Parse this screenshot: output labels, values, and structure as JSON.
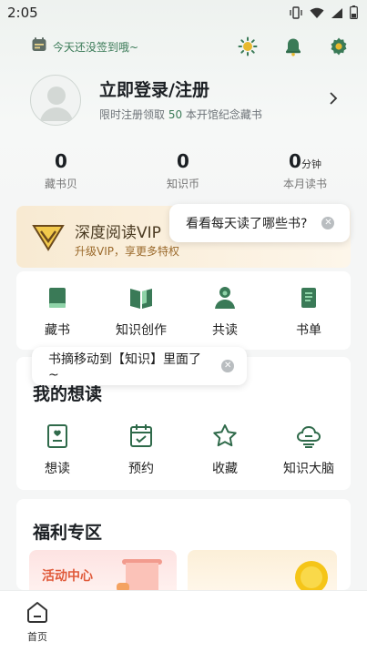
{
  "status_bar": {
    "time": "2:05"
  },
  "header": {
    "checkin_label": "今天还没签到哦~",
    "icons": [
      "sun-icon",
      "bell-icon",
      "settings-icon"
    ]
  },
  "profile": {
    "login_title": "立即登录/注册",
    "sub_prefix": "限时注册领取 ",
    "sub_highlight": "50",
    "sub_suffix": " 本开馆纪念藏书"
  },
  "stats": [
    {
      "value": "0",
      "unit": "",
      "label": "藏书贝"
    },
    {
      "value": "0",
      "unit": "",
      "label": "知识币"
    },
    {
      "value": "0",
      "unit": "分钟",
      "label": "本月读书"
    }
  ],
  "vip": {
    "title": "深度阅读VIP",
    "subtitle": "升级VIP，享更多特权"
  },
  "tooltips": {
    "reading_hint": "看看每天读了哪些书?",
    "excerpt_hint": "书摘移动到【知识】里面了~"
  },
  "quick_grid": [
    {
      "label": "藏书",
      "icon": "book-icon"
    },
    {
      "label": "知识创作",
      "icon": "open-book-icon"
    },
    {
      "label": "共读",
      "icon": "people-icon"
    },
    {
      "label": "书单",
      "icon": "list-icon"
    }
  ],
  "wishlist": {
    "title": "我的想读",
    "items": [
      {
        "label": "想读",
        "icon": "wish-book-icon"
      },
      {
        "label": "预约",
        "icon": "calendar-check-icon"
      },
      {
        "label": "收藏",
        "icon": "star-icon"
      },
      {
        "label": "知识大脑",
        "icon": "brain-cloud-icon"
      }
    ]
  },
  "welfare": {
    "title": "福利专区",
    "left_label": "活动中心"
  },
  "bottom_nav": {
    "home_label": "首页"
  },
  "colors": {
    "accent_green": "#3a7a57",
    "vip_gold": "#9b6a2c",
    "activity_red": "#e05a3a"
  }
}
